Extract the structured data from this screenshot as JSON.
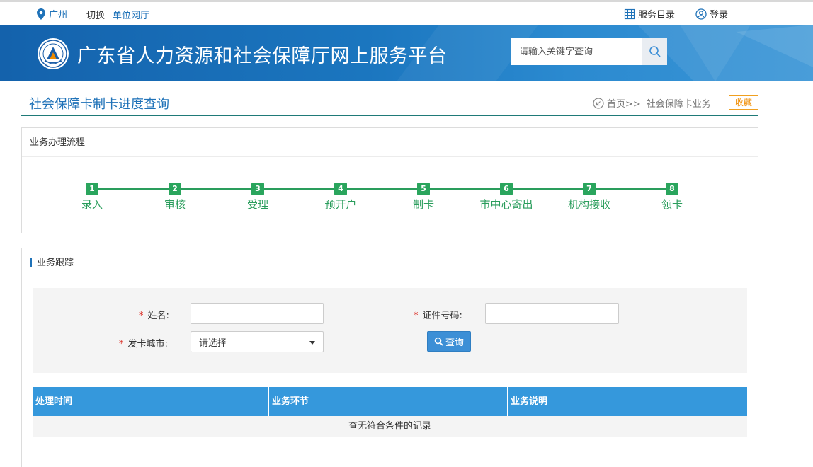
{
  "topbar": {
    "city": "广州",
    "switch_label": "切换",
    "unit_hall": "单位网厅",
    "service_dir": "服务目录",
    "login": "登录"
  },
  "banner": {
    "title": "广东省人力资源和社会保障厅网上服务平台",
    "search_placeholder": "请输入关键字查询"
  },
  "page": {
    "title": "社会保障卡制卡进度查询",
    "breadcrumb_home": "首页>>",
    "breadcrumb_current": "社会保障卡业务",
    "favorite": "收藏"
  },
  "flow": {
    "heading": "业务办理流程",
    "steps": [
      {
        "num": "1",
        "label": "录入"
      },
      {
        "num": "2",
        "label": "审核"
      },
      {
        "num": "3",
        "label": "受理"
      },
      {
        "num": "4",
        "label": "预开户"
      },
      {
        "num": "5",
        "label": "制卡"
      },
      {
        "num": "6",
        "label": "市中心寄出"
      },
      {
        "num": "7",
        "label": "机构接收"
      },
      {
        "num": "8",
        "label": "领卡"
      }
    ]
  },
  "tracking": {
    "heading": "业务跟踪",
    "required_mark": "*",
    "name_label": "姓名:",
    "id_label": "证件号码:",
    "city_label": "发卡城市:",
    "city_selected": "请选择",
    "query_button": "查询",
    "columns": [
      "处理时间",
      "业务环节",
      "业务说明"
    ],
    "empty_text": "查无符合条件的记录"
  },
  "colors": {
    "brand_blue": "#1f72b8",
    "step_green": "#2aa55d",
    "table_header": "#3598dc",
    "required_red": "#d9251c",
    "favorite_orange": "#f08c00"
  }
}
